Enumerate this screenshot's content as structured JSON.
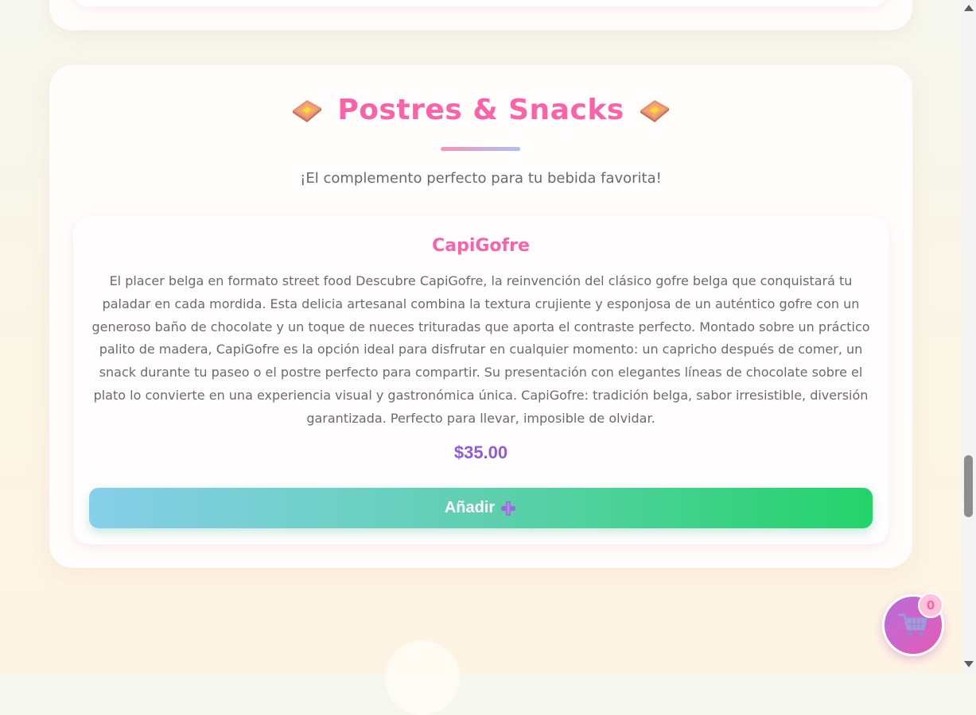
{
  "section": {
    "title": "Postres & Snacks",
    "title_icon": "waffle-icon",
    "subtitle": "¡El complemento perfecto para tu bebida favorita!"
  },
  "product": {
    "name": "CapiGofre",
    "description": "El placer belga en formato street food Descubre CapiGofre, la reinvención del clásico gofre belga que conquistará tu paladar en cada mordida. Esta delicia artesanal combina la textura crujiente y esponjosa de un auténtico gofre con un generoso baño de chocolate y un toque de nueces trituradas que aporta el contraste perfecto. Montado sobre un práctico palito de madera, CapiGofre es la opción ideal para disfrutar en cualquier momento: un capricho después de comer, un snack durante tu paseo o el postre perfecto para compartir. Su presentación con elegantes líneas de chocolate sobre el plato lo convierte en una experiencia visual y gastronómica única. CapiGofre: tradición belga, sabor irresistible, diversión garantizada. Perfecto para llevar, imposible de olvidar.",
    "price": "$35.00",
    "add_label": "Añadir",
    "add_icon": "plus-icon"
  },
  "cart": {
    "count": "0",
    "icon": "shopping-cart-icon"
  },
  "colors": {
    "accent_pink": "#fb62a8",
    "price_purple": "#8e5bd9",
    "button_start": "#87cfea",
    "button_end": "#24d36a",
    "cart_start": "#b86ddb",
    "cart_end": "#e45bb5"
  }
}
